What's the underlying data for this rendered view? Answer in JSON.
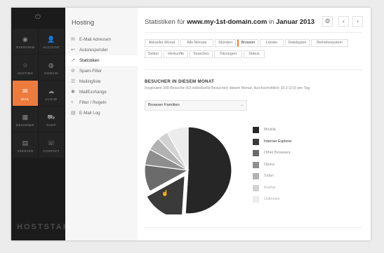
{
  "sidebar": {
    "tiles": [
      {
        "label": "Overview",
        "icon": "eye-icon",
        "glyph": "◉",
        "active": false
      },
      {
        "label": "Account",
        "icon": "user-icon",
        "glyph": "👤",
        "active": false
      },
      {
        "label": "Hosting",
        "icon": "star-icon",
        "glyph": "☆",
        "active": false
      },
      {
        "label": "Domain",
        "icon": "globe-icon",
        "glyph": "◍",
        "active": false
      },
      {
        "label": "Mail",
        "icon": "envelope-icon",
        "glyph": "✉",
        "active": true
      },
      {
        "label": "Cloud",
        "icon": "cloud-icon",
        "glyph": "☁",
        "active": false
      },
      {
        "label": "Designer",
        "icon": "grid-icon",
        "glyph": "▦",
        "active": false
      },
      {
        "label": "Shop",
        "icon": "cart-icon",
        "glyph": "⛟",
        "active": false
      },
      {
        "label": "vServer",
        "icon": "server-icon",
        "glyph": "▤",
        "active": false
      },
      {
        "label": "Contact",
        "icon": "phone-icon",
        "glyph": "☏",
        "active": false
      }
    ],
    "logo": "HOSTSTAR",
    "accent": "#ee7b3e"
  },
  "subnav": {
    "title": "Hosting",
    "items": [
      {
        "label": "E-Mail Adressen",
        "icon": "envelope-icon",
        "glyph": "✉",
        "active": false
      },
      {
        "label": "Autoresponder",
        "icon": "reply-icon",
        "glyph": "↩",
        "active": false
      },
      {
        "label": "Statistiken",
        "icon": "chart-icon",
        "glyph": "↗",
        "active": true
      },
      {
        "label": "Spam-Filter",
        "icon": "block-icon",
        "glyph": "⊘",
        "active": false
      },
      {
        "label": "Mailingliste",
        "icon": "list-icon",
        "glyph": "☰",
        "active": false
      },
      {
        "label": "MailExchange",
        "icon": "star-icon",
        "glyph": "✱",
        "active": false
      },
      {
        "label": "Filter / Regeln",
        "icon": "filter-icon",
        "glyph": "▿",
        "active": false
      },
      {
        "label": "E-Mail Log",
        "icon": "log-icon",
        "glyph": "▤",
        "active": false
      }
    ]
  },
  "header": {
    "title_prefix": "Statistiken für ",
    "domain": "www.my-1st-domain.com",
    "title_mid": " in ",
    "period": "Januar 2013",
    "settings_glyph": "⚙",
    "prev_glyph": "‹",
    "next_glyph": "›"
  },
  "tabs": [
    {
      "label": "Aktueller Monat",
      "active": false
    },
    {
      "label": "Alle Monate",
      "active": false
    },
    {
      "label": "Stunden",
      "active": false
    },
    {
      "label": "Browser",
      "active": true
    },
    {
      "label": "Länder",
      "active": false
    },
    {
      "label": "Dateitypen",
      "active": false
    },
    {
      "label": "Betriebssystem",
      "active": false
    },
    {
      "label": "Seiten",
      "active": false
    },
    {
      "label": "Herkunfte",
      "active": false
    },
    {
      "label": "Searches",
      "active": false
    },
    {
      "label": "Sitzungen",
      "active": false
    },
    {
      "label": "Status",
      "active": false
    }
  ],
  "section": {
    "title": "BESUCHER IN DIESEM MONAT",
    "subtitle": "Insgesamt 309 Besuche (63 individuelle Besucher) diesen Monat, durchschnittlich 10.3 (2.0) pro Tag",
    "select_value": "Browser Familien",
    "select_chevron": "⌄"
  },
  "chart_data": {
    "type": "pie",
    "series": [
      {
        "name": "Mozilla",
        "value": 51,
        "color": "#262626",
        "text_color": "#888888"
      },
      {
        "name": "Internet Explorer",
        "value": 16,
        "color": "#3a3a3a",
        "text_color": "#333333"
      },
      {
        "name": "Other Browsers",
        "value": 10,
        "color": "#6b6b6b",
        "text_color": "#888888"
      },
      {
        "name": "Opera",
        "value": 6,
        "color": "#8e8e8e",
        "text_color": "#888888"
      },
      {
        "name": "Safari",
        "value": 5,
        "color": "#b2b2b2",
        "text_color": "#999999"
      },
      {
        "name": "Firefox",
        "value": 4,
        "color": "#d2d2d2",
        "text_color": "#aaaaaa"
      },
      {
        "name": "Unknown",
        "value": 8,
        "color": "#ececec",
        "text_color": "#aaaaaa"
      }
    ],
    "exploded": "Internet Explorer"
  },
  "cursor_glyph": "☝"
}
